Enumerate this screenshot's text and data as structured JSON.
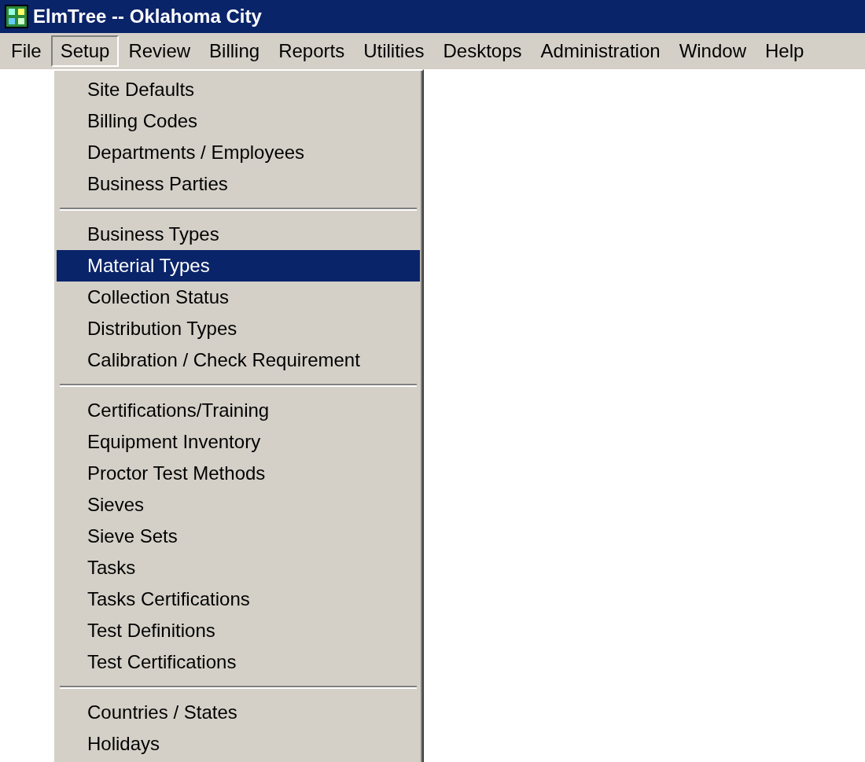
{
  "window": {
    "title": "ElmTree -- Oklahoma City"
  },
  "menu_bar": [
    {
      "label": "File",
      "selected": false
    },
    {
      "label": "Setup",
      "selected": true
    },
    {
      "label": "Review",
      "selected": false
    },
    {
      "label": "Billing",
      "selected": false
    },
    {
      "label": "Reports",
      "selected": false
    },
    {
      "label": "Utilities",
      "selected": false
    },
    {
      "label": "Desktops",
      "selected": false
    },
    {
      "label": "Administration",
      "selected": false
    },
    {
      "label": "Window",
      "selected": false
    },
    {
      "label": "Help",
      "selected": false
    }
  ],
  "dropdown": {
    "groups": [
      {
        "items": [
          {
            "label": "Site Defaults",
            "selected": false
          },
          {
            "label": "Billing Codes",
            "selected": false
          },
          {
            "label": "Departments / Employees",
            "selected": false
          },
          {
            "label": "Business Parties",
            "selected": false
          }
        ]
      },
      {
        "items": [
          {
            "label": "Business Types",
            "selected": false
          },
          {
            "label": "Material Types",
            "selected": true
          },
          {
            "label": "Collection Status",
            "selected": false
          },
          {
            "label": "Distribution Types",
            "selected": false
          },
          {
            "label": "Calibration / Check Requirement",
            "selected": false
          }
        ]
      },
      {
        "items": [
          {
            "label": "Certifications/Training",
            "selected": false
          },
          {
            "label": "Equipment Inventory",
            "selected": false
          },
          {
            "label": "Proctor Test Methods",
            "selected": false
          },
          {
            "label": "Sieves",
            "selected": false
          },
          {
            "label": "Sieve Sets",
            "selected": false
          },
          {
            "label": "Tasks",
            "selected": false
          },
          {
            "label": "Tasks Certifications",
            "selected": false
          },
          {
            "label": "Test Definitions",
            "selected": false
          },
          {
            "label": "Test Certifications",
            "selected": false
          }
        ]
      },
      {
        "items": [
          {
            "label": "Countries / States",
            "selected": false
          },
          {
            "label": "Holidays",
            "selected": false
          }
        ]
      }
    ]
  }
}
